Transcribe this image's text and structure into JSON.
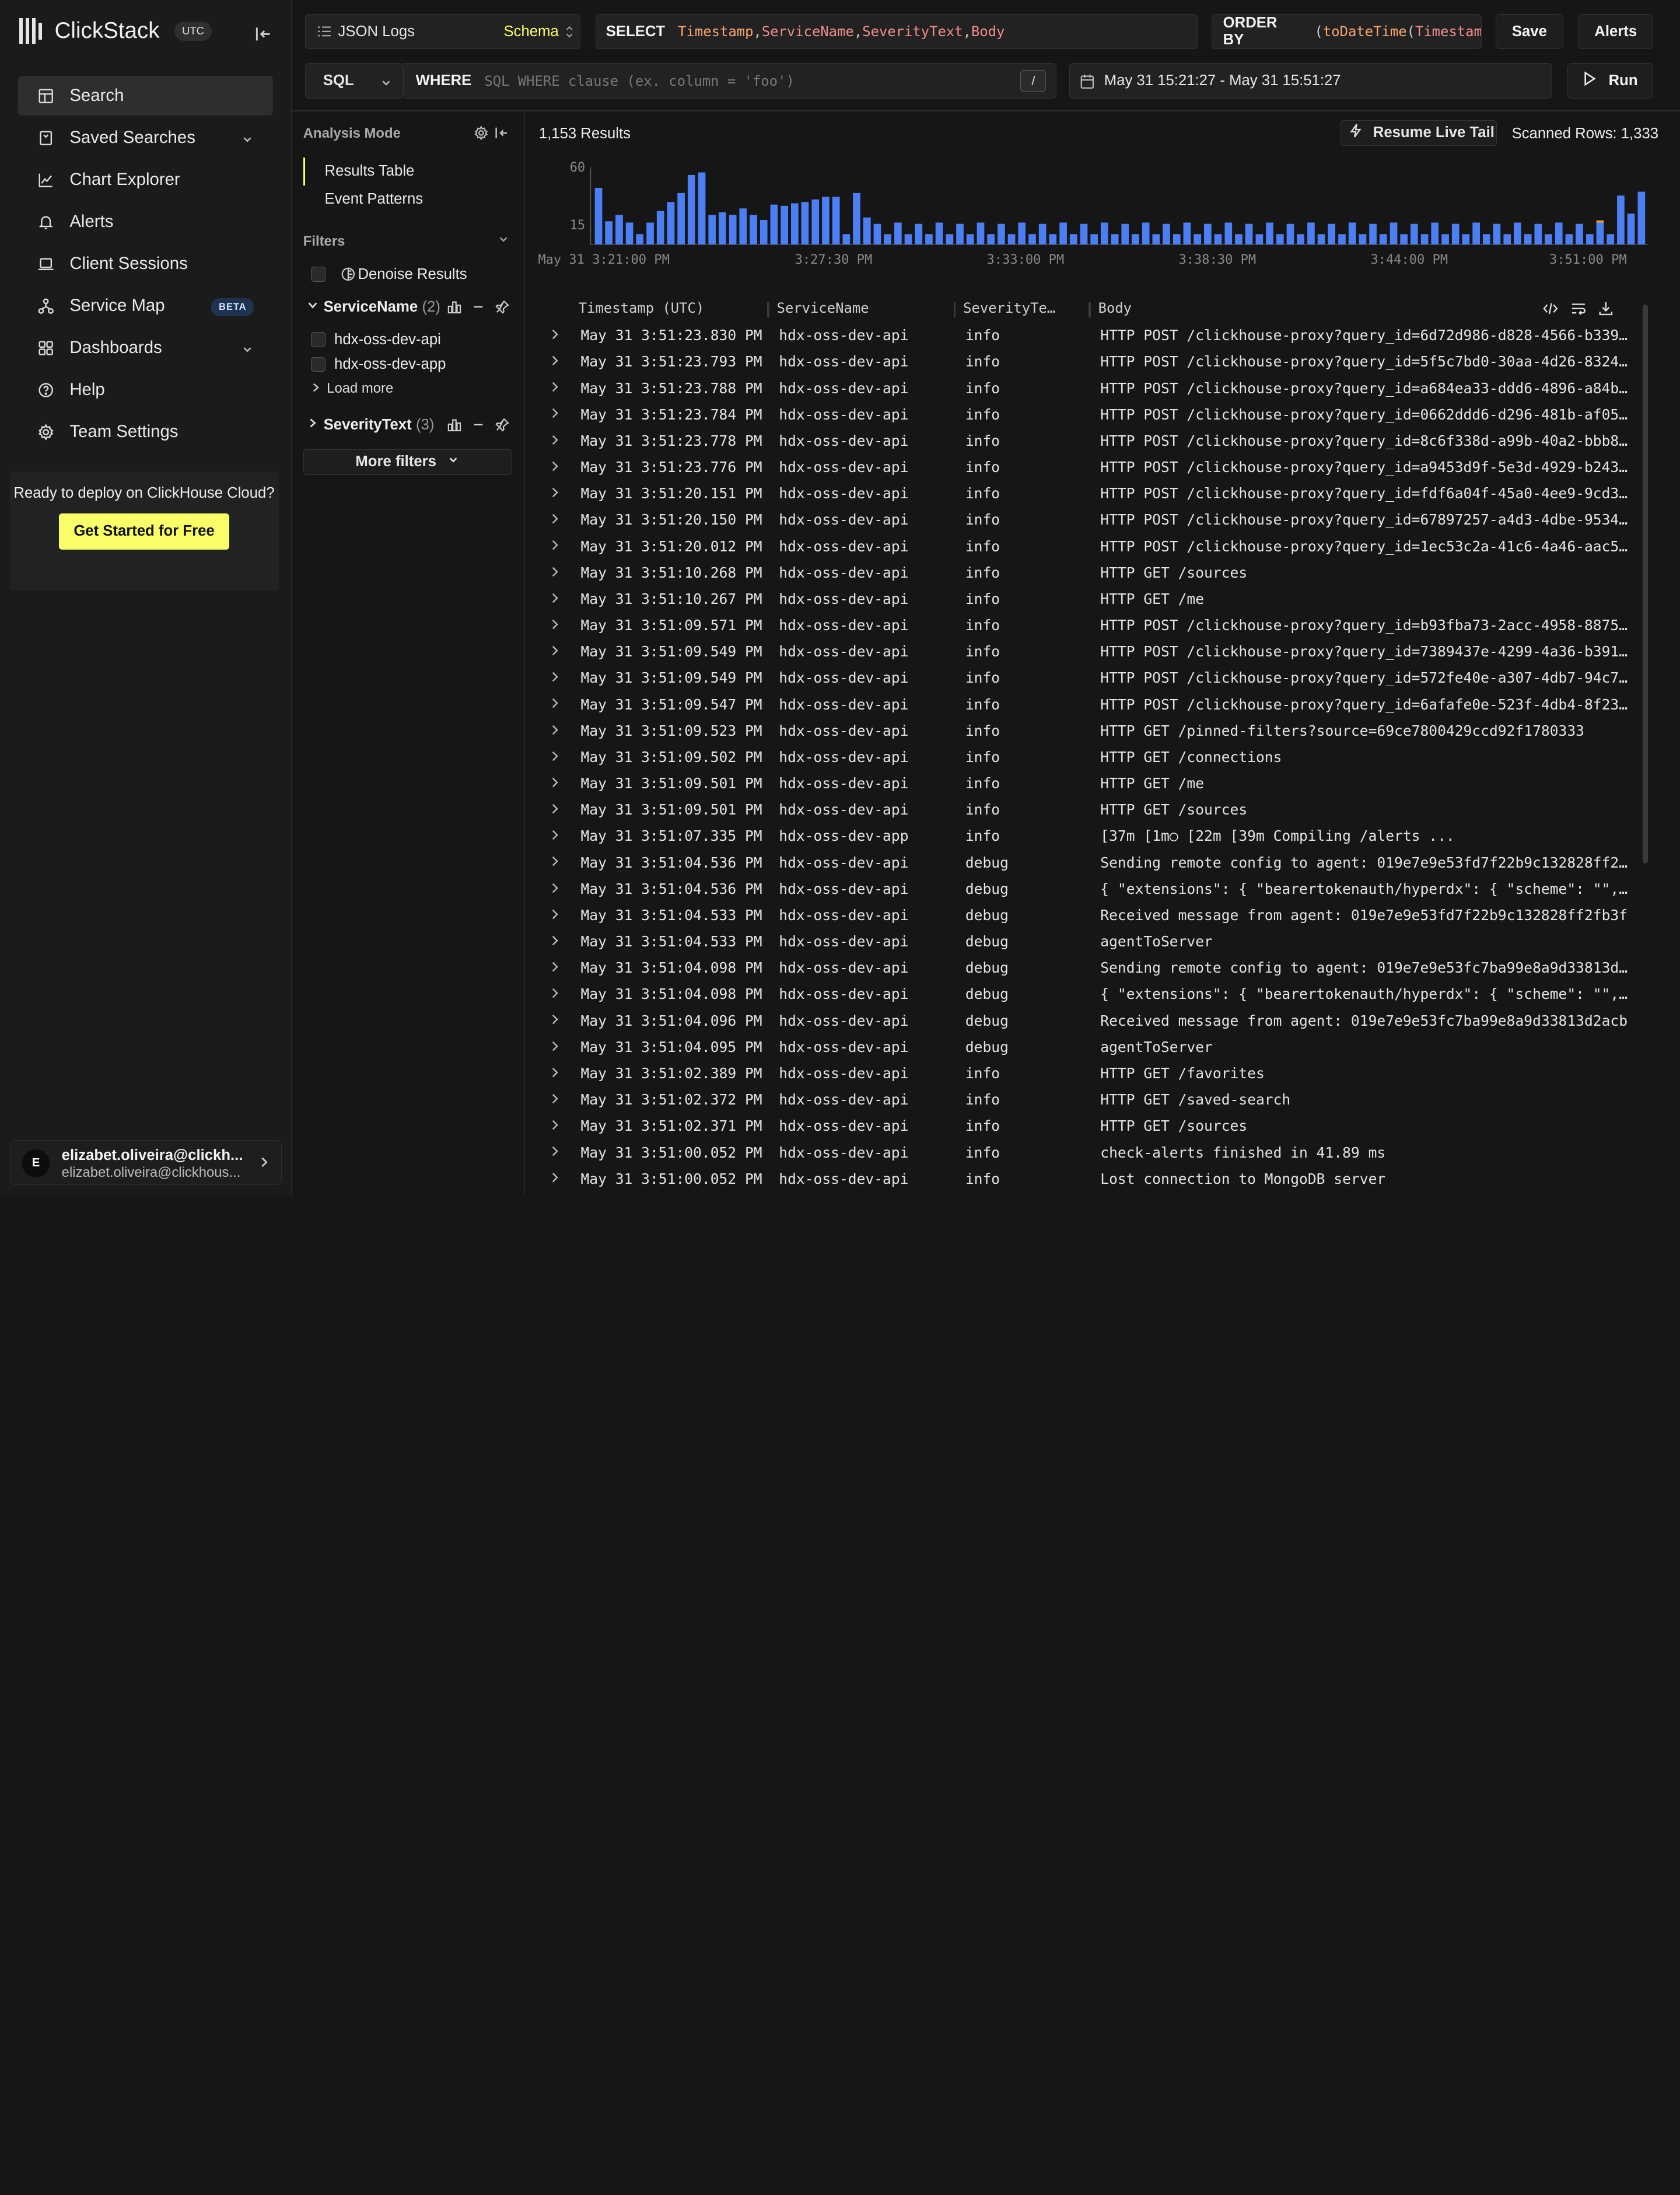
{
  "sidebar": {
    "brand": "ClickStack",
    "tz_badge": "UTC",
    "nav": [
      {
        "label": "Search"
      },
      {
        "label": "Saved Searches"
      },
      {
        "label": "Chart Explorer"
      },
      {
        "label": "Alerts"
      },
      {
        "label": "Client Sessions"
      },
      {
        "label": "Service Map",
        "badge": "BETA"
      },
      {
        "label": "Dashboards"
      },
      {
        "label": "Help"
      },
      {
        "label": "Team Settings"
      }
    ],
    "deploy": {
      "text": "Ready to deploy on ClickHouse Cloud?",
      "button": "Get Started for Free"
    },
    "user": {
      "initial": "E",
      "name": "elizabet.oliveira@clickh...",
      "email": "elizabet.oliveira@clickhous..."
    }
  },
  "toolbar": {
    "source": "JSON Logs",
    "schema_label": "Schema",
    "select_kw": "SELECT",
    "select_fields": [
      "Timestamp",
      "ServiceName",
      "SeverityText",
      "Body"
    ],
    "orderby_kw": "ORDER BY",
    "orderby_fn": "toDateTime",
    "orderby_arg": "Timestam",
    "save": "Save",
    "alerts": "Alerts",
    "language": "SQL",
    "where_kw": "WHERE",
    "where_placeholder": "SQL WHERE clause (ex. column = 'foo')",
    "slash": "/",
    "time_range": "May 31 15:21:27 - May 31 15:51:27",
    "run": "Run"
  },
  "analysis": {
    "title": "Analysis Mode",
    "modes": [
      "Results Table",
      "Event Patterns"
    ],
    "filters_title": "Filters",
    "denoise": "Denoise Results",
    "groups": [
      {
        "name": "ServiceName",
        "count": "(2)",
        "values": [
          "hdx-oss-dev-api",
          "hdx-oss-dev-app"
        ],
        "load_more": "Load more"
      },
      {
        "name": "SeverityText",
        "count": "(3)"
      }
    ],
    "more_filters": "More filters"
  },
  "results": {
    "count": "1,153 Results",
    "live_tail": "Resume Live Tail",
    "scanned": "Scanned Rows: 1,333",
    "columns": [
      "Timestamp (UTC)",
      "ServiceName",
      "SeverityTe…",
      "Body"
    ],
    "rows": [
      [
        "May 31 3:51:23.830 PM",
        "hdx-oss-dev-api",
        "info",
        "HTTP POST /clickhouse-proxy?query_id=6d72d986-d828-4566-b339-9…"
      ],
      [
        "May 31 3:51:23.793 PM",
        "hdx-oss-dev-api",
        "info",
        "HTTP POST /clickhouse-proxy?query_id=5f5c7bd0-30aa-4d26-8324-c…"
      ],
      [
        "May 31 3:51:23.788 PM",
        "hdx-oss-dev-api",
        "info",
        "HTTP POST /clickhouse-proxy?query_id=a684ea33-ddd6-4896-a84b-0…"
      ],
      [
        "May 31 3:51:23.784 PM",
        "hdx-oss-dev-api",
        "info",
        "HTTP POST /clickhouse-proxy?query_id=0662ddd6-d296-481b-af05-3…"
      ],
      [
        "May 31 3:51:23.778 PM",
        "hdx-oss-dev-api",
        "info",
        "HTTP POST /clickhouse-proxy?query_id=8c6f338d-a99b-40a2-bbb8-8…"
      ],
      [
        "May 31 3:51:23.776 PM",
        "hdx-oss-dev-api",
        "info",
        "HTTP POST /clickhouse-proxy?query_id=a9453d9f-5e3d-4929-b243-6…"
      ],
      [
        "May 31 3:51:20.151 PM",
        "hdx-oss-dev-api",
        "info",
        "HTTP POST /clickhouse-proxy?query_id=fdf6a04f-45a0-4ee9-9cd3-2…"
      ],
      [
        "May 31 3:51:20.150 PM",
        "hdx-oss-dev-api",
        "info",
        "HTTP POST /clickhouse-proxy?query_id=67897257-a4d3-4dbe-9534-5…"
      ],
      [
        "May 31 3:51:20.012 PM",
        "hdx-oss-dev-api",
        "info",
        "HTTP POST /clickhouse-proxy?query_id=1ec53c2a-41c6-4a46-aac5-c…"
      ],
      [
        "May 31 3:51:10.268 PM",
        "hdx-oss-dev-api",
        "info",
        "HTTP GET /sources"
      ],
      [
        "May 31 3:51:10.267 PM",
        "hdx-oss-dev-api",
        "info",
        "HTTP GET /me"
      ],
      [
        "May 31 3:51:09.571 PM",
        "hdx-oss-dev-api",
        "info",
        "HTTP POST /clickhouse-proxy?query_id=b93fba73-2acc-4958-8875-6…"
      ],
      [
        "May 31 3:51:09.549 PM",
        "hdx-oss-dev-api",
        "info",
        "HTTP POST /clickhouse-proxy?query_id=7389437e-4299-4a36-b391-e…"
      ],
      [
        "May 31 3:51:09.549 PM",
        "hdx-oss-dev-api",
        "info",
        "HTTP POST /clickhouse-proxy?query_id=572fe40e-a307-4db7-94c7-b…"
      ],
      [
        "May 31 3:51:09.547 PM",
        "hdx-oss-dev-api",
        "info",
        "HTTP POST /clickhouse-proxy?query_id=6afafe0e-523f-4db4-8f23-d…"
      ],
      [
        "May 31 3:51:09.523 PM",
        "hdx-oss-dev-api",
        "info",
        "HTTP GET /pinned-filters?source=69ce7800429ccd92f1780333"
      ],
      [
        "May 31 3:51:09.502 PM",
        "hdx-oss-dev-api",
        "info",
        "HTTP GET /connections"
      ],
      [
        "May 31 3:51:09.501 PM",
        "hdx-oss-dev-api",
        "info",
        "HTTP GET /me"
      ],
      [
        "May 31 3:51:09.501 PM",
        "hdx-oss-dev-api",
        "info",
        "HTTP GET /sources"
      ],
      [
        "May 31 3:51:07.335 PM",
        "hdx-oss-dev-app",
        "info",
        " [37m [1m○ [22m [39m Compiling /alerts ..."
      ],
      [
        "May 31 3:51:04.536 PM",
        "hdx-oss-dev-api",
        "debug",
        "Sending remote config to agent: 019e7e9e53fd7f22b9c132828ff2fb…"
      ],
      [
        "May 31 3:51:04.536 PM",
        "hdx-oss-dev-api",
        "debug",
        "{ \"extensions\": { \"bearertokenauth/hyperdx\": { \"scheme\": \"\", \"…"
      ],
      [
        "May 31 3:51:04.533 PM",
        "hdx-oss-dev-api",
        "debug",
        "Received message from agent: 019e7e9e53fd7f22b9c132828ff2fb3f"
      ],
      [
        "May 31 3:51:04.533 PM",
        "hdx-oss-dev-api",
        "debug",
        "agentToServer"
      ],
      [
        "May 31 3:51:04.098 PM",
        "hdx-oss-dev-api",
        "debug",
        "Sending remote config to agent: 019e7e9e53fc7ba99e8a9d33813d2a…"
      ],
      [
        "May 31 3:51:04.098 PM",
        "hdx-oss-dev-api",
        "debug",
        "{ \"extensions\": { \"bearertokenauth/hyperdx\": { \"scheme\": \"\", \"…"
      ],
      [
        "May 31 3:51:04.096 PM",
        "hdx-oss-dev-api",
        "debug",
        "Received message from agent: 019e7e9e53fc7ba99e8a9d33813d2acb"
      ],
      [
        "May 31 3:51:04.095 PM",
        "hdx-oss-dev-api",
        "debug",
        "agentToServer"
      ],
      [
        "May 31 3:51:02.389 PM",
        "hdx-oss-dev-api",
        "info",
        "HTTP GET /favorites"
      ],
      [
        "May 31 3:51:02.372 PM",
        "hdx-oss-dev-api",
        "info",
        "HTTP GET /saved-search"
      ],
      [
        "May 31 3:51:02.371 PM",
        "hdx-oss-dev-api",
        "info",
        "HTTP GET /sources"
      ],
      [
        "May 31 3:51:00.052 PM",
        "hdx-oss-dev-api",
        "info",
        "check-alerts finished in 41.89 ms"
      ],
      [
        "May 31 3:51:00.052 PM",
        "hdx-oss-dev-api",
        "info",
        "Lost connection to MongoDB server"
      ]
    ]
  },
  "chart_data": {
    "type": "bar",
    "ylim": [
      0,
      60
    ],
    "yticks": [
      15,
      60
    ],
    "xticks": [
      "May 31 3:21:00 PM",
      "3:27:30 PM",
      "3:33:00 PM",
      "3:38:30 PM",
      "3:44:00 PM",
      "3:51:00 PM"
    ],
    "values": [
      44,
      18,
      23,
      17,
      8,
      17,
      26,
      33,
      40,
      54,
      56,
      23,
      25,
      23,
      28,
      23,
      19,
      31,
      30,
      32,
      33,
      35,
      37,
      37,
      8,
      40,
      21,
      16,
      8,
      17,
      8,
      16,
      8,
      17,
      8,
      16,
      8,
      17,
      8,
      16,
      8,
      17,
      8,
      16,
      8,
      17,
      8,
      16,
      8,
      17,
      8,
      16,
      8,
      17,
      8,
      16,
      8,
      17,
      8,
      16,
      8,
      17,
      8,
      16,
      8,
      17,
      8,
      16,
      8,
      17,
      8,
      16,
      8,
      17,
      8,
      16,
      8,
      17,
      8,
      16,
      8,
      17,
      8,
      16,
      8,
      17,
      8,
      16,
      8,
      17,
      8,
      16,
      8,
      17,
      8,
      16,
      8,
      17,
      8,
      38,
      24,
      41
    ],
    "colors": {
      "bar": "#4c7ff4",
      "highlight": "#e8a33a"
    }
  }
}
